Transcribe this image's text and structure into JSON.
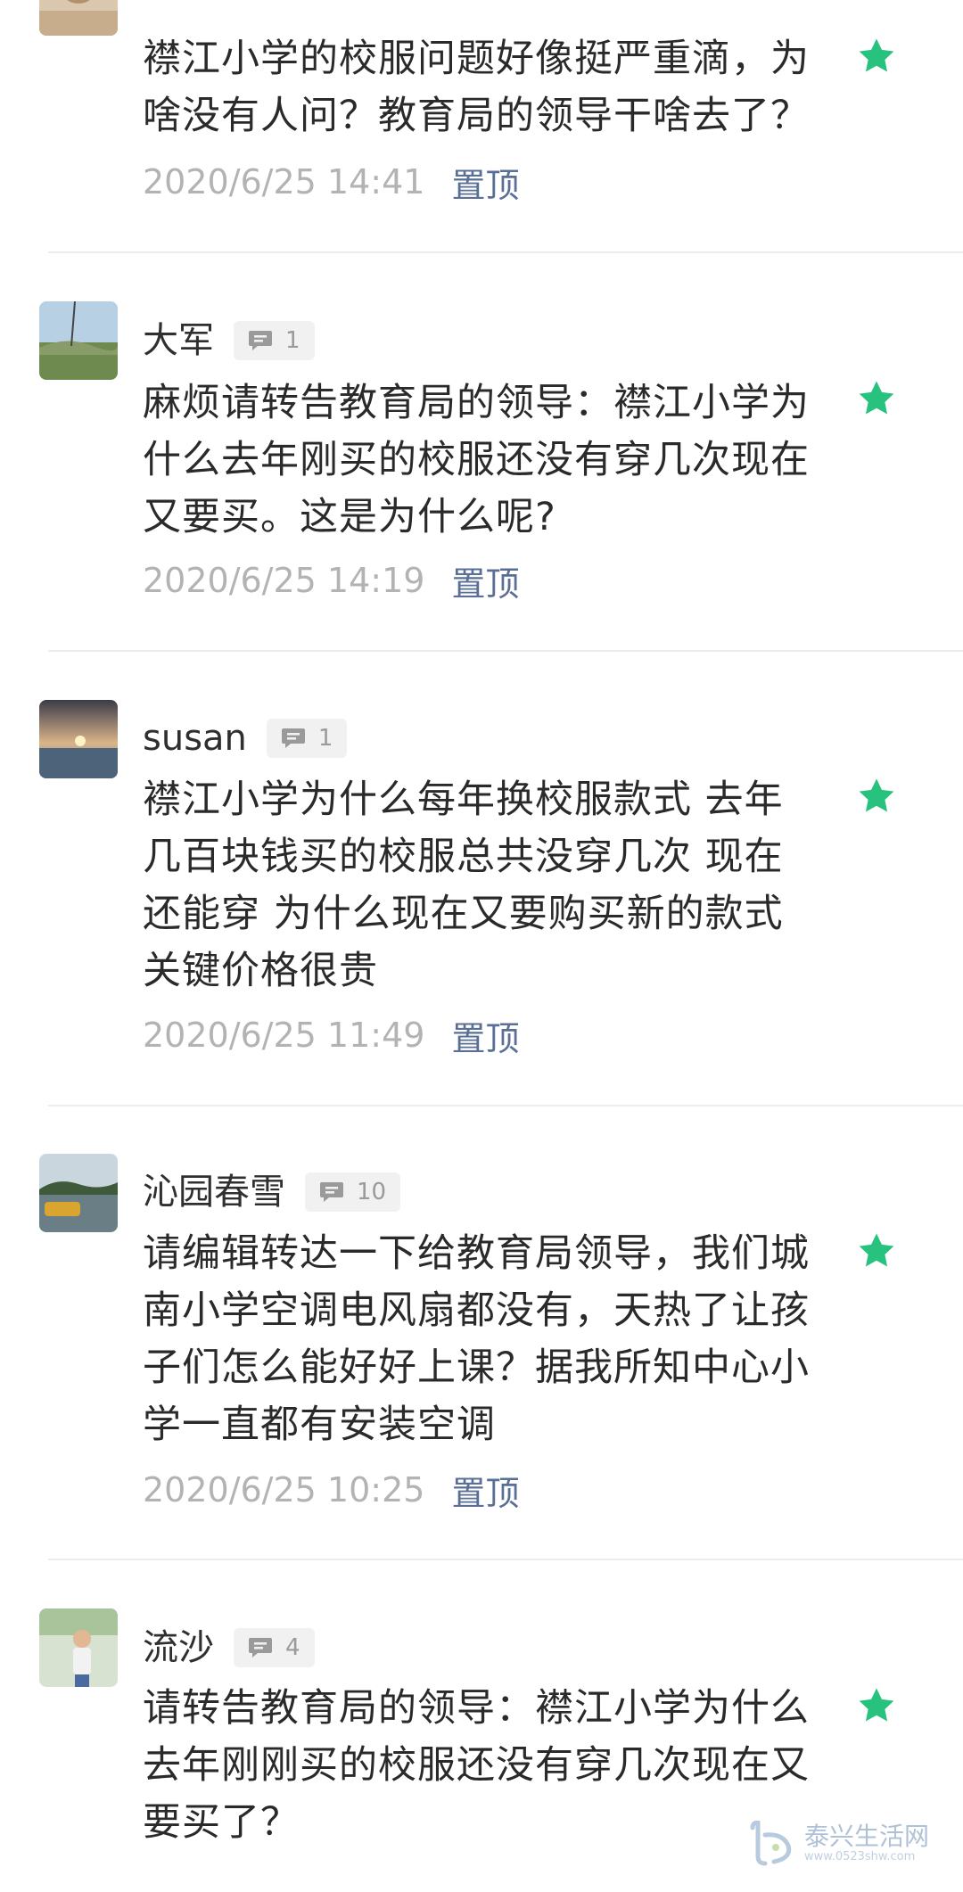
{
  "comments": [
    {
      "name": "",
      "reply_count": "",
      "text": "襟江小学的校服问题好像挺严重滴，为啥没有人问？教育局的领导干啥去了？",
      "date": "2020/6/25 14:41",
      "pin_label": "置顶"
    },
    {
      "name": "大军",
      "reply_count": "1",
      "text": "麻烦请转告教育局的领导：襟江小学为什么去年刚买的校服还没有穿几次现在又要买。这是为什么呢?",
      "date": "2020/6/25 14:19",
      "pin_label": "置顶"
    },
    {
      "name": "susan",
      "reply_count": "1",
      "text": "襟江小学为什么每年换校服款式 去年几百块钱买的校服总共没穿几次 现在还能穿 为什么现在又要购买新的款式关键价格很贵",
      "date": "2020/6/25 11:49",
      "pin_label": "置顶"
    },
    {
      "name": "沁园春雪",
      "reply_count": "10",
      "text": "请编辑转达一下给教育局领导，我们城南小学空调电风扇都没有，天热了让孩子们怎么能好好上课？据我所知中心小学一直都有安装空调",
      "date": "2020/6/25 10:25",
      "pin_label": "置顶"
    },
    {
      "name": "流沙",
      "reply_count": "4",
      "text": "请转告教育局的领导：襟江小学为什么去年刚刚买的校服还没有穿几次现在又要买了？",
      "date": "",
      "pin_label": ""
    }
  ],
  "watermark": {
    "title": "泰兴生活网",
    "url": "www.0523shw.com"
  },
  "colors": {
    "star": "#27c27e",
    "pin": "#5a6f95",
    "date": "#b3b3b3",
    "divider": "#ececec"
  },
  "icons": {
    "star": "star-icon",
    "reply": "comment-bubble-icon"
  }
}
